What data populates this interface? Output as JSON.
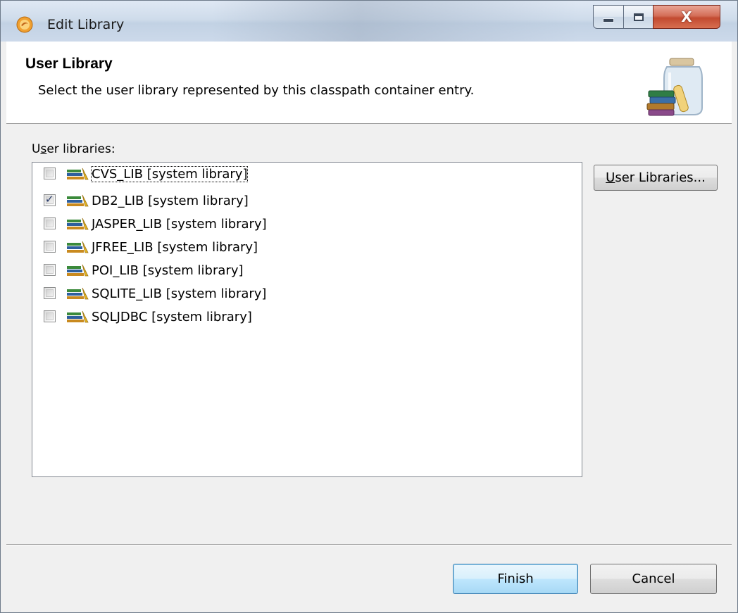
{
  "window": {
    "title": "Edit Library",
    "controls": {
      "close_glyph": "X"
    }
  },
  "banner": {
    "title": "User Library",
    "description": "Select the user library represented by this classpath container entry.",
    "icon": "library-jar-icon"
  },
  "libraries_section": {
    "label_prefix": "U",
    "label_mnemonic": "s",
    "label_rest": "er libraries:",
    "items": [
      {
        "label": "CVS_LIB [system library]",
        "checked": false
      },
      {
        "label": "DB2_LIB [system library]",
        "checked": true
      },
      {
        "label": "JASPER_LIB [system library]",
        "checked": false
      },
      {
        "label": "JFREE_LIB [system library]",
        "checked": false
      },
      {
        "label": "POI_LIB [system library]",
        "checked": false
      },
      {
        "label": "SQLITE_LIB [system library]",
        "checked": false
      },
      {
        "label": "SQLJDBC [system library]",
        "checked": false
      }
    ]
  },
  "buttons": {
    "user_libraries_mnemonic": "U",
    "user_libraries_rest": "ser Libraries...",
    "finish": "Finish",
    "cancel": "Cancel"
  },
  "colors": {
    "finish_border": "#3c7fb1",
    "close_button": "#c24a30",
    "checkmark": "#2a3c6a"
  }
}
